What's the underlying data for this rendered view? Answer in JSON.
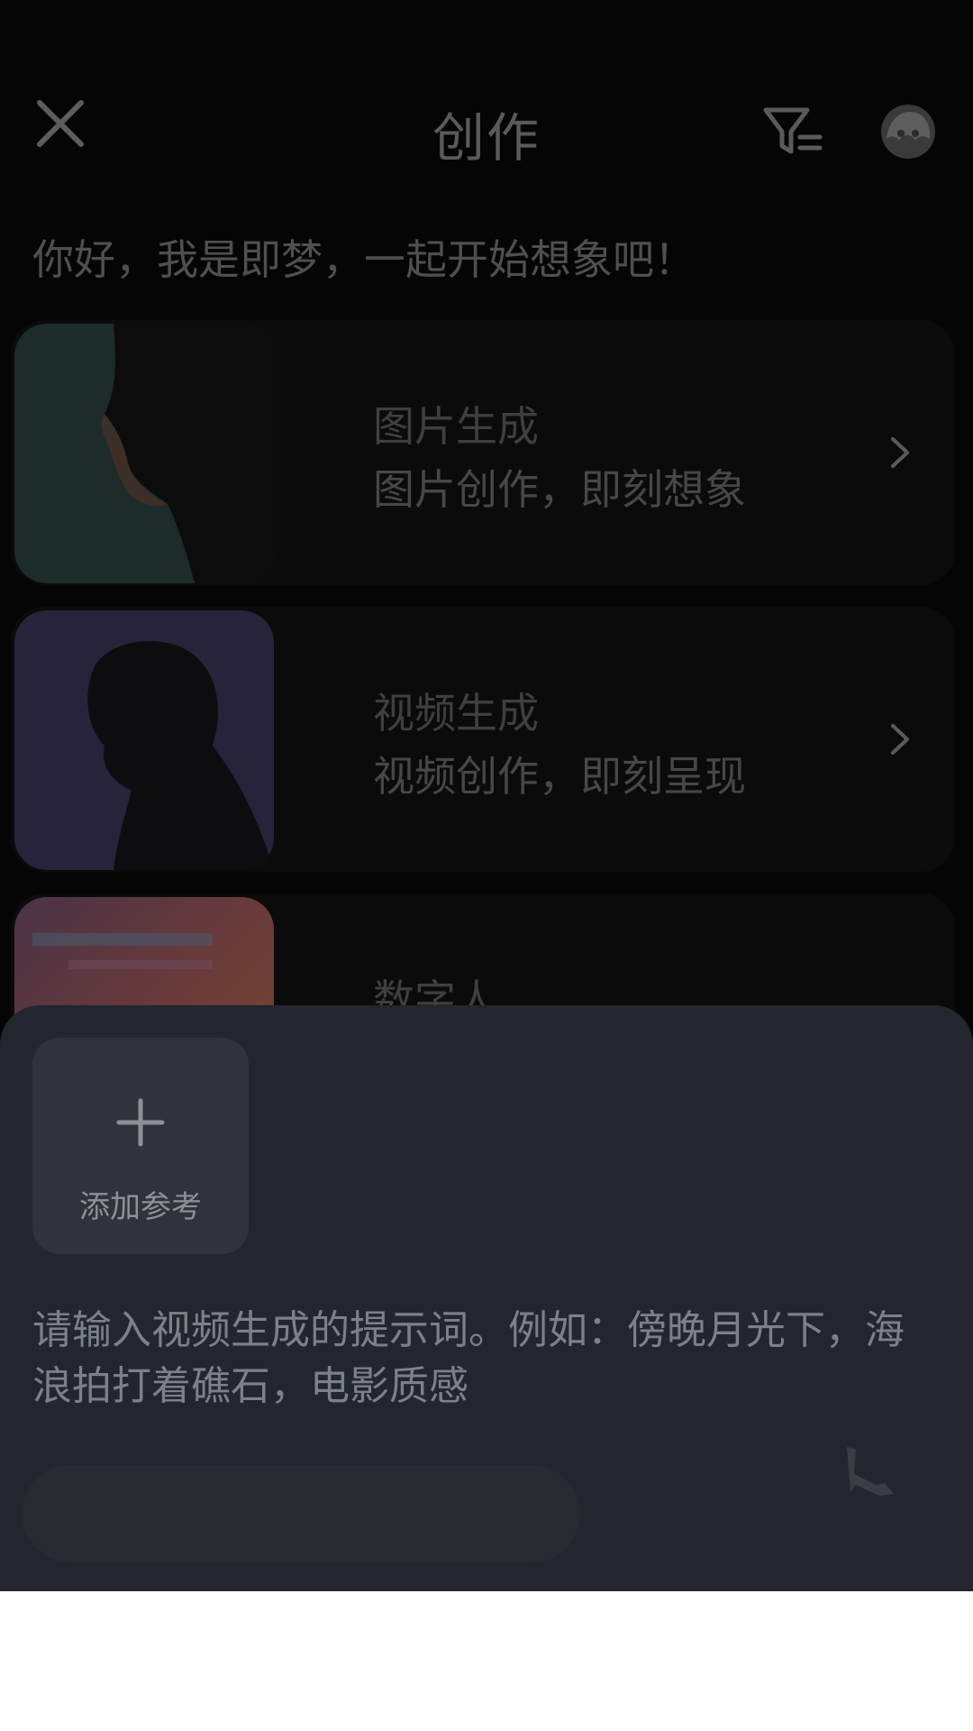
{
  "header": {
    "title": "创作",
    "close_icon": "close-icon",
    "filter_icon": "filter-icon",
    "avatar_icon": "avatar-icon"
  },
  "greeting": "你好，我是即梦，一起开始想象吧！",
  "features": [
    {
      "title": "图片生成",
      "subtitle": "图片创作，即刻想象",
      "icon": "chevron-right-icon"
    },
    {
      "title": "视频生成",
      "subtitle": "视频创作，即刻呈现",
      "icon": "chevron-right-icon"
    },
    {
      "title": "数字人",
      "subtitle": "",
      "icon": "chevron-right-icon"
    }
  ],
  "composer": {
    "add_reference_label": "添加参考",
    "add_icon": "plus-icon",
    "prompt_placeholder": "请输入视频生成的提示词。例如：傍晚月光下，海浪拍打着礁石，电影质感"
  },
  "colors": {
    "background": "#050505",
    "sheet": "#23262e",
    "add_ref_tile": "#30333b"
  }
}
